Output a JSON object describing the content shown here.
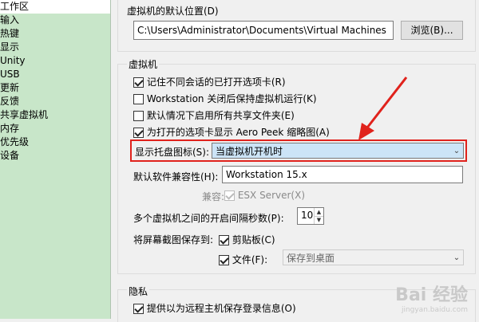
{
  "sidebar": {
    "items": [
      {
        "label": "工作区",
        "selected": true
      },
      {
        "label": "输入"
      },
      {
        "label": "热键"
      },
      {
        "label": "显示"
      },
      {
        "label": "Unity"
      },
      {
        "label": "USB"
      },
      {
        "label": "更新"
      },
      {
        "label": "反馈"
      },
      {
        "label": "共享虚拟机"
      },
      {
        "label": "内存"
      },
      {
        "label": "优先级"
      },
      {
        "label": "设备"
      }
    ]
  },
  "location": {
    "label": "虚拟机的默认位置(D)",
    "value": "C:\\Users\\Administrator\\Documents\\Virtual Machines",
    "browse_button": "浏览(B)..."
  },
  "vm": {
    "label": "虚拟机",
    "options": [
      {
        "label": "记住不同会话的已打开选项卡(R)",
        "checked": true
      },
      {
        "label": "Workstation 关闭后保持虚拟机运行(K)",
        "checked": false
      },
      {
        "label": "默认情况下启用所有共享文件夹(E)",
        "checked": false
      },
      {
        "label": "为打开的选项卡显示 Aero Peek 缩略图(A)",
        "checked": true
      }
    ],
    "tray_icon": {
      "label": "显示托盘图标(S):",
      "value": "当虚拟机开机时"
    },
    "compat": {
      "label": "默认软件兼容性(H):",
      "value": "Workstation 15.x"
    },
    "compat2": {
      "label": "兼容:",
      "checkbox_label": "ESX Server(X)",
      "checked": true,
      "disabled": true
    },
    "interval": {
      "label": "多个虚拟机之间的开启间隔秒数(P):",
      "value": "10"
    },
    "screenshot": {
      "label": "将屏幕截图保存到:",
      "clipboard": {
        "label": "剪贴板(C)",
        "checked": true
      },
      "file": {
        "label": "文件(F):",
        "checked": true,
        "value": "保存到桌面"
      }
    }
  },
  "privacy": {
    "label": "隐私",
    "option": {
      "label": "提供以为远程主机保存登录信息(O)",
      "checked": true
    }
  },
  "watermark": {
    "text": "Bai 经验",
    "sub": "jingyan.baidu.com"
  },
  "colors": {
    "sidebar_bg": "#c8e6c9",
    "highlight": "#e0221c",
    "selection": "#cce4f7"
  }
}
